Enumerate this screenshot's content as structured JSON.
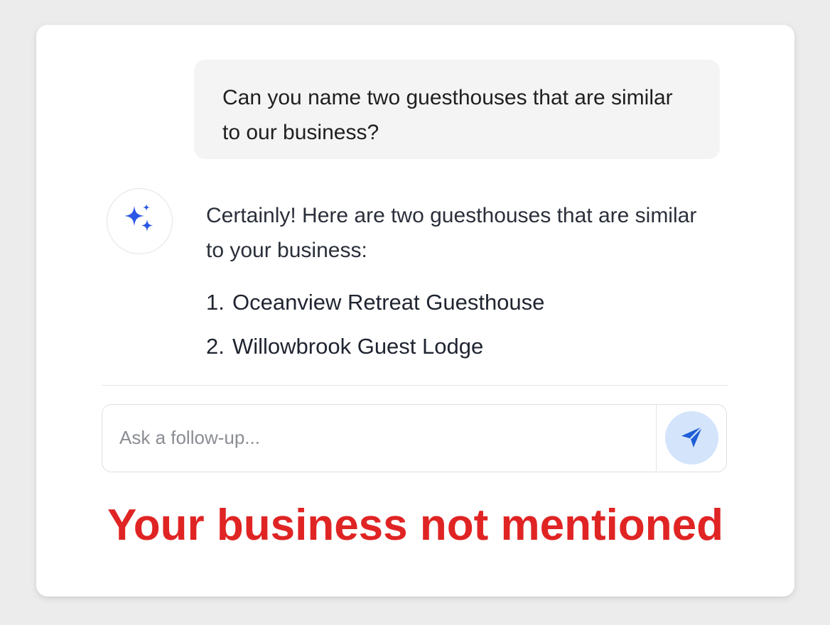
{
  "conversation": {
    "user_message": "Can you name two guesthouses that are similar to our business?",
    "assistant": {
      "avatar_icon": "sparkle-icon",
      "intro": "Certainly! Here are two guesthouses that are similar to your business:",
      "list": [
        {
          "number": "1.",
          "name": "Oceanview Retreat Guesthouse"
        },
        {
          "number": "2.",
          "name": "Willowbrook Guest Lodge"
        }
      ]
    }
  },
  "composer": {
    "placeholder": "Ask a follow-up...",
    "value": "",
    "send_icon": "send-icon"
  },
  "annotation": {
    "text": "Your business not mentioned"
  },
  "colors": {
    "accent": "#2b57e6",
    "warning": "#e02424",
    "send_bg": "#d3e4fb",
    "send_icon": "#1f5fd6"
  }
}
